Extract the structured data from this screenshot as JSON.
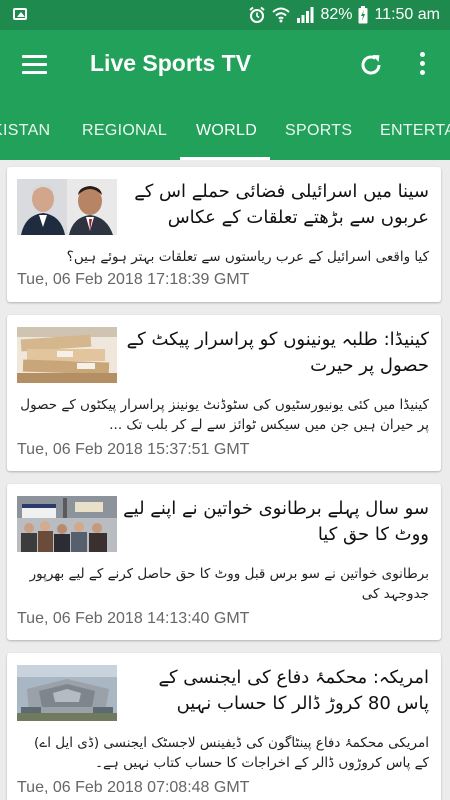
{
  "status_bar": {
    "battery_percent": "82%",
    "time": "11:50 am",
    "icons": [
      "image-notification-icon",
      "alarm-icon",
      "wifi-icon",
      "signal-icon",
      "battery-icon"
    ]
  },
  "app_bar": {
    "title": "Live Sports TV",
    "icons": [
      "menu-icon",
      "refresh-icon",
      "more-vert-icon"
    ]
  },
  "tabs": [
    {
      "label": "KISTAN",
      "active": false
    },
    {
      "label": "REGIONAL",
      "active": false
    },
    {
      "label": "WORLD",
      "active": true
    },
    {
      "label": "SPORTS",
      "active": false
    },
    {
      "label": "ENTERTA",
      "active": false
    }
  ],
  "colors": {
    "toolbar": "#21a15a",
    "status_bar": "#1e8a4e",
    "background": "#ececec"
  },
  "articles": [
    {
      "headline": "سینا میں اسرائیلی فضائی حملے اس کے عربوں سے بڑھتے تعلقات کے عکاس",
      "summary": "کیا واقعی اسرائیل کے عرب ریاستوں سے تعلقات بہتر ہوئے ہیں؟",
      "date": "Tue, 06 Feb 2018 17:18:39 GMT"
    },
    {
      "headline": "کینیڈا: طلبہ یونینوں کو پراسرار پیکٹ کے حصول پر حیرت",
      "summary": "کینیڈا میں کئی یونیورسٹیوں کی سٹوڈنٹ یونینز پراسرار پیکٹوں کے حصول پر حیران ہیں جن میں سیکس ٹوائز سے لے کر بلب تک ...",
      "date": "Tue, 06 Feb 2018 15:37:51 GMT"
    },
    {
      "headline": "سو سال پہلے برطانوی خواتین نے اپنے لیے ووٹ کا حق کیا",
      "summary": "برطانوی خواتین نے سو برس قبل ووٹ کا حق حاصل کرنے کے لیے بھرپور جدوجہد کی",
      "date": "Tue, 06 Feb 2018 14:13:40 GMT"
    },
    {
      "headline": "امریکہ: محکمۂ دفاع کی ایجنسی کے پاس 80 کروڑ ڈالر کا حساب نہیں",
      "summary": "امریکی محکمۂ دفاع پینٹاگون کی ڈیفینس لاجسٹک ایجنسی (ڈی ایل اے) کے پاس کروڑوں ڈالر کے اخراجات کا حساب کتاب نہیں ہے۔",
      "date": "Tue, 06 Feb 2018 07:08:48 GMT"
    }
  ]
}
